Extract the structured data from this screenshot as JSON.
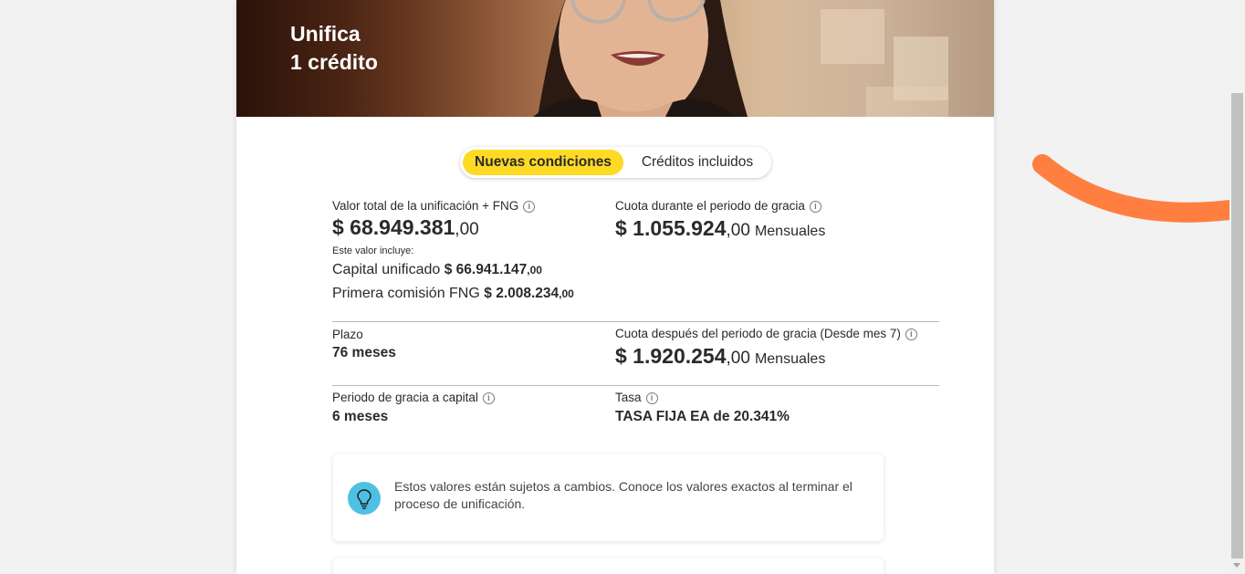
{
  "hero": {
    "title_line1": "Unifica",
    "title_line2": "1 crédito"
  },
  "tabs": [
    {
      "label": "Nuevas condiciones",
      "active": true
    },
    {
      "label": "Créditos incluidos",
      "active": false
    }
  ],
  "summary": {
    "total": {
      "label": "Valor total de la unificación + FNG",
      "amount": "$ 68.949.381",
      "cents": ",00",
      "includes_label": "Este valor incluye:",
      "capital_label": "Capital unificado",
      "capital_amount": "$ 66.941.147",
      "capital_cents": ",00",
      "fng_label": "Primera comisión FNG",
      "fng_amount": "$ 2.008.234",
      "fng_cents": ",00"
    },
    "grace_fee": {
      "label": "Cuota durante el periodo de gracia",
      "amount": "$ 1.055.924",
      "cents": ",00",
      "unit": "Mensuales"
    },
    "term": {
      "label": "Plazo",
      "value": "76 meses"
    },
    "after_grace_fee": {
      "label": "Cuota después del periodo de gracia (Desde mes 7)",
      "amount": "$ 1.920.254",
      "cents": ",00",
      "unit": "Mensuales"
    },
    "grace_period": {
      "label": "Periodo de gracia a capital",
      "value": "6 meses"
    },
    "rate": {
      "label": "Tasa",
      "value": "TASA FIJA EA de 20.341%"
    }
  },
  "notice": {
    "text": "Estos valores están sujetos a cambios. Conoce los valores exactos al terminar el proceso de unificación.",
    "icon": "lightbulb-icon"
  },
  "info_icon_glyph": "i",
  "colors": {
    "accent_yellow": "#fdda24",
    "deco_orange": "#ff7f41",
    "notice_icon_blue": "#4ec0e4"
  }
}
